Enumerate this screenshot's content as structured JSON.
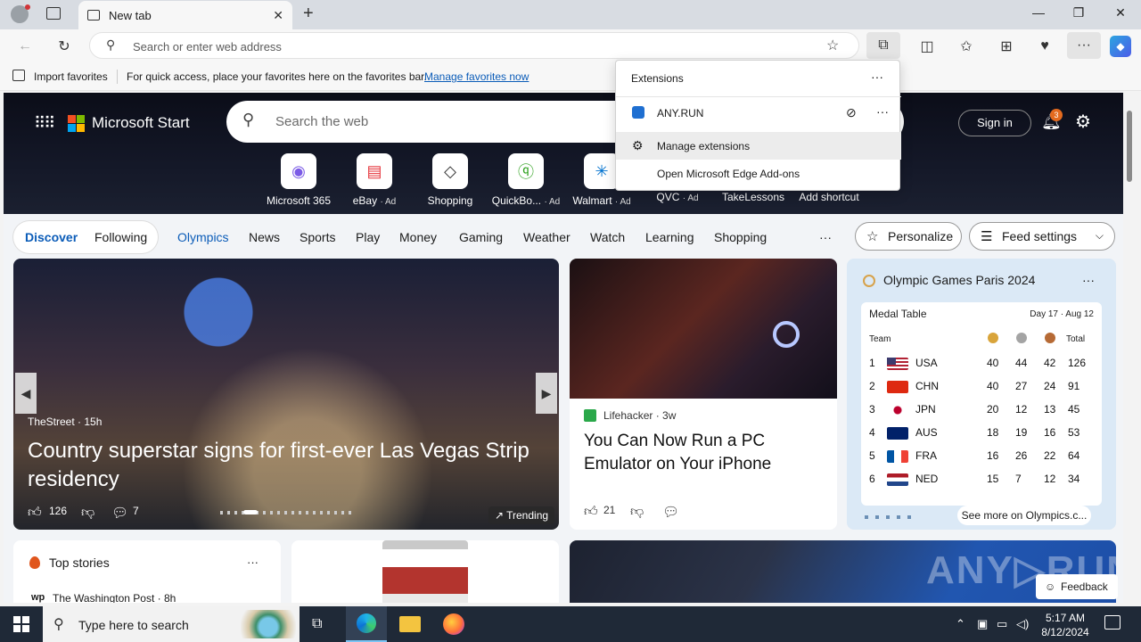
{
  "browser": {
    "tab_title": "New tab",
    "address_placeholder": "Search or enter web address"
  },
  "favorites_bar": {
    "import_label": "Import favorites",
    "hint": "For quick access, place your favorites here on the favorites bar.",
    "manage_link": "Manage favorites now"
  },
  "extensions_popup": {
    "title": "Extensions",
    "items": [
      {
        "label": "ANY.RUN"
      },
      {
        "label": "Manage extensions"
      },
      {
        "label": "Open Microsoft Edge Add-ons"
      }
    ]
  },
  "msstart": {
    "brand": "Microsoft Start",
    "search_placeholder": "Search the web",
    "signin": "Sign in",
    "notif_count": "3",
    "quick_links": [
      {
        "label": "Microsoft 365",
        "ad": ""
      },
      {
        "label": "eBay",
        "ad": "· Ad"
      },
      {
        "label": "Shopping",
        "ad": ""
      },
      {
        "label": "QuickBo...",
        "ad": "· Ad"
      },
      {
        "label": "Walmart",
        "ad": "· Ad"
      },
      {
        "label": "QVC",
        "ad": "· Ad"
      },
      {
        "label": "TakeLessons",
        "ad": ""
      },
      {
        "label": "Add shortcut",
        "ad": ""
      }
    ]
  },
  "nav": {
    "discover": "Discover",
    "following": "Following",
    "items": [
      "Olympics",
      "News",
      "Sports",
      "Play",
      "Money",
      "Gaming",
      "Weather",
      "Watch",
      "Learning",
      "Shopping"
    ],
    "more": "···",
    "personalize": "Personalize",
    "feed_settings": "Feed settings"
  },
  "hero_story": {
    "source": "TheStreet · 15h",
    "title": "Country superstar signs for first-ever Las Vegas Strip residency",
    "likes": "126",
    "comments": "7",
    "badge": "Trending"
  },
  "mid_story": {
    "source": "Lifehacker · 3w",
    "title": "You Can Now Run a PC Emulator on Your iPhone",
    "likes": "21"
  },
  "olympics": {
    "title": "Olympic Games Paris 2024",
    "table_title": "Medal Table",
    "date_range": "Day 17 · Aug 12",
    "col_team": "Team",
    "col_total": "Total",
    "rows": [
      {
        "rank": "1",
        "team": "USA",
        "gold": "40",
        "silver": "44",
        "bronze": "42",
        "total": "126"
      },
      {
        "rank": "2",
        "team": "CHN",
        "gold": "40",
        "silver": "27",
        "bronze": "24",
        "total": "91"
      },
      {
        "rank": "3",
        "team": "JPN",
        "gold": "20",
        "silver": "12",
        "bronze": "13",
        "total": "45"
      },
      {
        "rank": "4",
        "team": "AUS",
        "gold": "18",
        "silver": "19",
        "bronze": "16",
        "total": "53"
      },
      {
        "rank": "5",
        "team": "FRA",
        "gold": "16",
        "silver": "26",
        "bronze": "22",
        "total": "64"
      },
      {
        "rank": "6",
        "team": "NED",
        "gold": "15",
        "silver": "7",
        "bronze": "12",
        "total": "34"
      }
    ],
    "more_link": "See more on Olympics.c..."
  },
  "top_stories": {
    "title": "Top stories",
    "source": "The Washington Post · 8h"
  },
  "feedback": "Feedback",
  "taskbar": {
    "search_placeholder": "Type here to search",
    "time": "5:17 AM",
    "date": "8/12/2024"
  },
  "colors": {
    "accent": "#0b5cb8",
    "nav_active": "#0b5cb8",
    "taskbar": "#1f2937"
  }
}
